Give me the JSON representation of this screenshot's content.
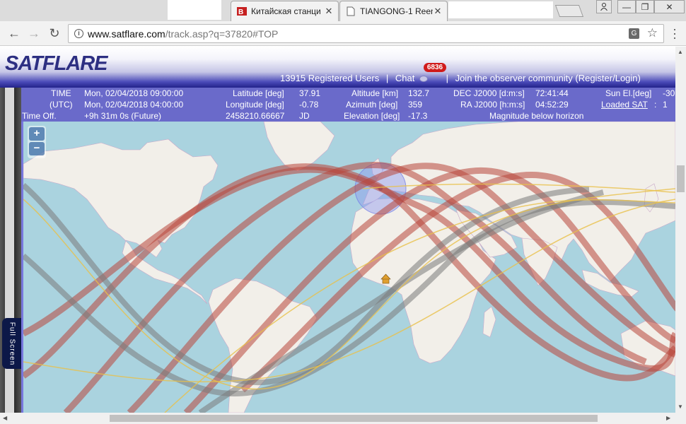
{
  "browser": {
    "tabs": [
      {
        "title": "Китайская станци",
        "favicon": "red-b-favicon",
        "active": false
      },
      {
        "title": "TIANGONG-1 Reent",
        "favicon": "page-icon",
        "active": true
      }
    ],
    "url_host": "www.satflare.com",
    "url_path": "/track.asp?q=37820#TOP",
    "icons": [
      "back-icon",
      "forward-icon",
      "reload-icon",
      "info-icon",
      "translate-icon",
      "star-icon",
      "menu-icon",
      "user-icon",
      "minimize-icon",
      "restore-icon",
      "close-icon"
    ]
  },
  "header": {
    "logo": "SATFLARE",
    "registered": "13915 Registered Users",
    "chat_label": "Chat",
    "chat_count": "6836",
    "join_text": "Join the observer community (Register/Login)",
    "separator": "|"
  },
  "info": {
    "time_label": "TIME",
    "time_value": "Mon, 02/04/2018 09:00:00",
    "utc_label": "(UTC)",
    "utc_value": "Mon, 02/04/2018 04:00:00",
    "timeoff_label": "Time Off.",
    "timeoff_value": "+9h 31m 0s (Future)",
    "lat_label": "Latitude [deg]",
    "lat_value": "37.91",
    "lon_label": "Longitude [deg]",
    "lon_value": "-0.78",
    "jd_num": "2458210.66667",
    "jd_label": "JD",
    "alt_label": "Altitude [km]",
    "alt_value": "132.7",
    "az_label": "Azimuth [deg]",
    "az_value": "359",
    "el_label": "Elevation [deg]",
    "el_value": "-17.3",
    "dec_label": "DEC J2000 [d:m:s]",
    "dec_value": "72:41:44",
    "ra_label": "RA J2000 [h:m:s]",
    "ra_value": "04:52:29",
    "mag_text": "Magnitude  below horizon",
    "sunel_label": "Sun El.[deg]",
    "sunel_value": "-30",
    "loaded_label": "Loaded SAT",
    "loaded_colon": ":",
    "loaded_value": "1"
  },
  "map": {
    "zoom_in": "+",
    "zoom_out": "−",
    "fullscreen": "Full Screen",
    "colors": {
      "water": "#aad3df",
      "land": "#f2efe9",
      "track": "#b8463a",
      "track_gray": "#7a7a7a",
      "track_yellow": "#e8c04a"
    }
  }
}
